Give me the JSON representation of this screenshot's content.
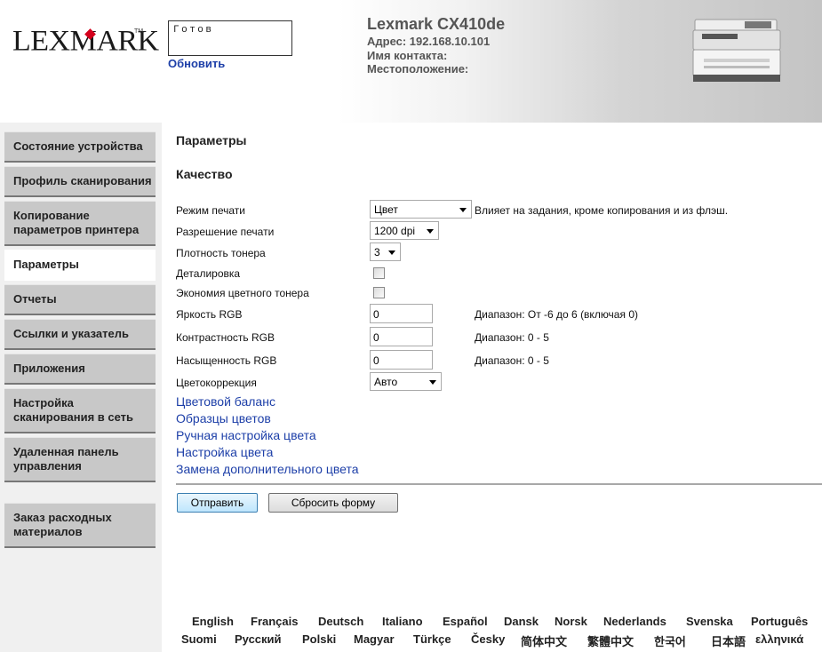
{
  "header": {
    "logo_text": "LEXMARK",
    "logo_tm": "TM",
    "status_text": "Готов",
    "refresh_label": "Обновить",
    "printer_name": "Lexmark CX410de",
    "address": "Адрес: 192.168.10.101",
    "contact": "Имя контакта:",
    "location": "Местоположение:"
  },
  "sidebar": {
    "items": [
      {
        "label": "Состояние устройства"
      },
      {
        "label": "Профиль сканирования"
      },
      {
        "label": "Копирование параметров принтера"
      },
      {
        "label": "Параметры"
      },
      {
        "label": "Отчеты"
      },
      {
        "label": "Ссылки и указатель"
      },
      {
        "label": "Приложения"
      },
      {
        "label": "Настройка сканирования в сеть"
      },
      {
        "label": "Удаленная панель управления"
      },
      {
        "label": "Заказ расходных материалов"
      }
    ]
  },
  "main": {
    "page_title": "Параметры",
    "section_title": "Качество",
    "print_mode": {
      "label": "Режим печати",
      "value": "Цвет",
      "note": "Влияет на задания, кроме копирования и из флэш."
    },
    "print_resolution": {
      "label": "Разрешение печати",
      "value": "1200 dpi"
    },
    "toner_darkness": {
      "label": "Плотность тонера",
      "value": "3"
    },
    "enhance_fine_lines": {
      "label": "Деталировка"
    },
    "color_saver": {
      "label": "Экономия цветного тонера"
    },
    "rgb_brightness": {
      "label": "Яркость RGB",
      "value": "0",
      "note": "Диапазон: От -6 до 6 (включая 0)"
    },
    "rgb_contrast": {
      "label": "Контрастность RGB",
      "value": "0",
      "note": "Диапазон: 0 - 5"
    },
    "rgb_saturation": {
      "label": "Насыщенность RGB",
      "value": "0",
      "note": "Диапазон: 0 - 5"
    },
    "color_correction": {
      "label": "Цветокоррекция",
      "value": "Авто"
    },
    "links": [
      "Цветовой баланс",
      "Образцы цветов",
      "Ручная настройка цвета",
      "Настройка цвета",
      "Замена дополнительного цвета"
    ],
    "submit_label": "Отправить",
    "reset_label": "Сбросить форму"
  },
  "languages": {
    "row1": [
      "English",
      "Français",
      "Deutsch",
      "Italiano",
      "Español",
      "Dansk",
      "Norsk",
      "Nederlands",
      "Svenska",
      "Português"
    ],
    "row2": [
      "Suomi",
      "Русский",
      "Polski",
      "Magyar",
      "Türkçe",
      "Česky",
      "简体中文",
      "繁體中文",
      "한국어",
      "日本語",
      "ελληνικά"
    ]
  }
}
